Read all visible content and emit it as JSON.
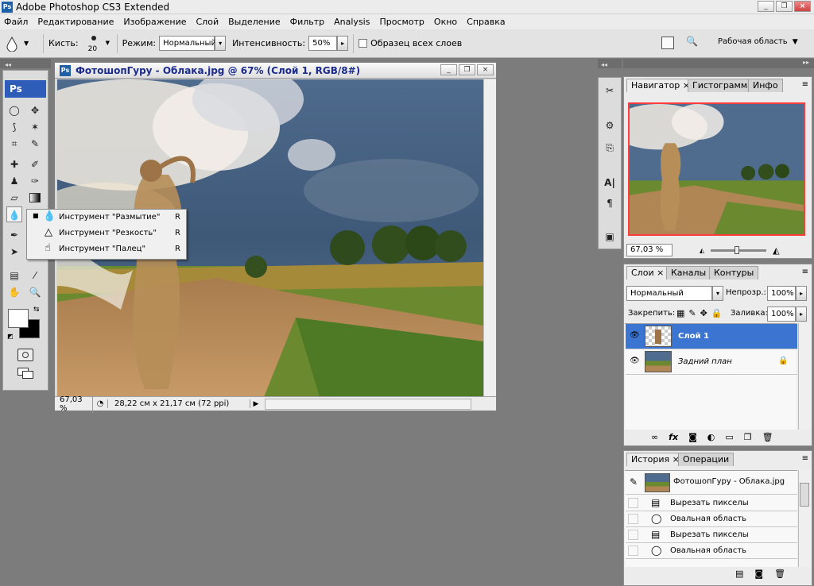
{
  "app": {
    "title": "Adobe Photoshop CS3 Extended",
    "logo_text": "Ps"
  },
  "menu": [
    "Файл",
    "Редактирование",
    "Изображение",
    "Слой",
    "Выделение",
    "Фильтр",
    "Analysis",
    "Просмотр",
    "Окно",
    "Справка"
  ],
  "options": {
    "brush_label": "Кисть:",
    "brush_size": "20",
    "mode_label": "Режим:",
    "mode_value": "Нормальный",
    "intensity_label": "Интенсивность:",
    "intensity_value": "50%",
    "sample_all_label": "Образец всех слоев",
    "workspace_label": "Рабочая область"
  },
  "toolbox": {
    "ps_label": "Ps"
  },
  "flyout": {
    "items": [
      {
        "label": "Инструмент \"Размытие\"",
        "key": "R"
      },
      {
        "label": "Инструмент \"Резкость\"",
        "key": "R"
      },
      {
        "label": "Инструмент \"Палец\"",
        "key": "R"
      }
    ]
  },
  "document": {
    "title": "ФотошопГуру - Облака.jpg @ 67% (Слой 1, RGB/8#)",
    "zoom": "67,03 %",
    "doc_size": "28,22 см x 21,17 см (72 ppi)"
  },
  "navigator": {
    "tabs": [
      "Навигатор",
      "Гистограмма",
      "Инфо"
    ],
    "zoom": "67,03 %"
  },
  "layers": {
    "tabs": [
      "Слои",
      "Каналы",
      "Контуры"
    ],
    "blend_mode": "Нормальный",
    "opacity_label": "Непрозр.:",
    "opacity_value": "100%",
    "lock_label": "Закрепить:",
    "fill_label": "Заливка:",
    "fill_value": "100%",
    "items": [
      {
        "name": "Слой 1"
      },
      {
        "name": "Задний план"
      }
    ]
  },
  "history": {
    "tabs": [
      "История",
      "Операции"
    ],
    "snapshot": "ФотошопГуру - Облака.jpg",
    "items": [
      {
        "label": "Вырезать пикселы"
      },
      {
        "label": "Овальная область"
      },
      {
        "label": "Вырезать пикселы"
      },
      {
        "label": "Овальная область"
      }
    ]
  },
  "colors": {
    "selection_blue": "#3c74d2",
    "titlebar_blue": "#1a2b8c",
    "navigator_frame": "#ff3b3b"
  }
}
